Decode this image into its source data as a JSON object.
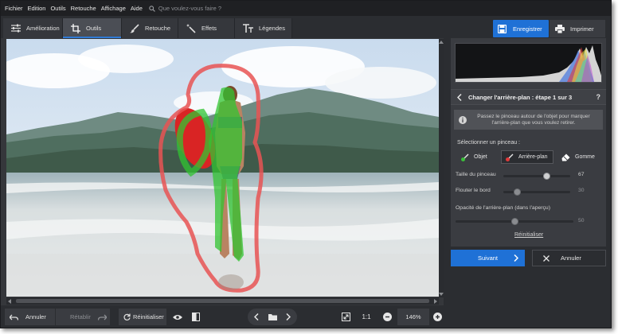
{
  "menu": {
    "items": [
      "Fichier",
      "Edition",
      "Outils",
      "Retouche",
      "Affichage",
      "Aide"
    ],
    "search_placeholder": "Que voulez-vous faire ?"
  },
  "tabs": [
    {
      "label": "Amélioration",
      "icon": "sliders-icon",
      "active": false
    },
    {
      "label": "Outils",
      "icon": "crop-icon",
      "active": true
    },
    {
      "label": "Retouche",
      "icon": "brush-icon",
      "active": false
    },
    {
      "label": "Effets",
      "icon": "magic-wand-icon",
      "active": false
    },
    {
      "label": "Légendes",
      "icon": "text-icon",
      "active": false
    }
  ],
  "actions": {
    "save_label": "Enregistrer",
    "print_label": "Imprimer"
  },
  "bottom": {
    "undo_label": "Annuler",
    "redo_label": "Rétablir",
    "reset_label": "Réinitialiser",
    "ratio_label": "1:1",
    "zoom_value": "146%"
  },
  "panel": {
    "step_title": "Changer l'arrière-plan : étape 1 sur 3",
    "help": "?",
    "info_text": "Passez le pinceau autour de l'objet pour marquer l'arrière-plan que vous voulez retirer.",
    "brush_title": "Sélectionner un pinceau :",
    "brushes": [
      {
        "label": "Objet",
        "active": false,
        "color": "#3bbf3b"
      },
      {
        "label": "Arrière-plan",
        "active": true,
        "color": "#e03a3a"
      },
      {
        "label": "Gomme",
        "active": false,
        "color": "#ffffff"
      }
    ],
    "sliders": [
      {
        "label": "Taille du pinceau",
        "value": "67",
        "fraction": 0.67,
        "enabled": true
      },
      {
        "label": "Flouter le bord",
        "value": "30",
        "fraction": 0.3,
        "enabled": false
      },
      {
        "label": "Opacité de l'arrière-plan (dans l'aperçu)",
        "value": "50",
        "fraction": 0.5,
        "enabled": false
      }
    ],
    "reset_link": "Réinitialiser",
    "next_label": "Suivant",
    "cancel_label": "Annuler"
  },
  "colors": {
    "accent": "#1f71d6",
    "object_brush": "#3bbf3b",
    "background_brush": "#e03a3a"
  }
}
